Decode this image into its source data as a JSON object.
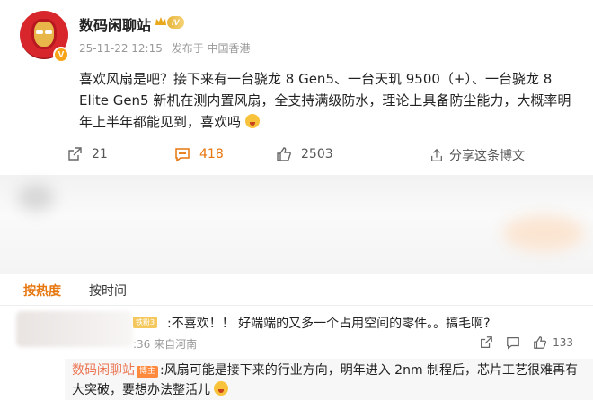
{
  "post": {
    "username": "数码闲聊站",
    "level_badge": "IV",
    "verified_badge": "V",
    "timestamp": "25-11-22 12:15",
    "location": "发布于 中国香港",
    "content": "喜欢风扇是吧？接下来有一台骁龙 8 Gen5、一台天玑 9500（+）、一台骁龙 8 Elite Gen5 新机在测内置风扇，全支持满级防水，理论上具备防尘能力，大概率明年上半年都能见到，喜欢吗",
    "actions": {
      "repost_count": "21",
      "comment_count": "418",
      "like_count": "2503",
      "share_label": "分享这条博文"
    }
  },
  "sort_tabs": {
    "hot": "按热度",
    "time": "按时间"
  },
  "comment": {
    "fan_badge": "铁粉3",
    "text": ":不喜欢！！ 好端端的又多一个占用空间的零件。。搞毛啊?",
    "meta": ":36 来自河南",
    "like_count": "133"
  },
  "reply": {
    "username": "数码闲聊站",
    "badge": "博主",
    "text": ":风扇可能是接下来的行业方向，明年进入 2nm 制程后，芯片工艺很难再有大突破，要想办法整活儿"
  },
  "colors": {
    "accent": "#e6760e",
    "reply_user": "#eb7350",
    "meta": "#999999"
  }
}
